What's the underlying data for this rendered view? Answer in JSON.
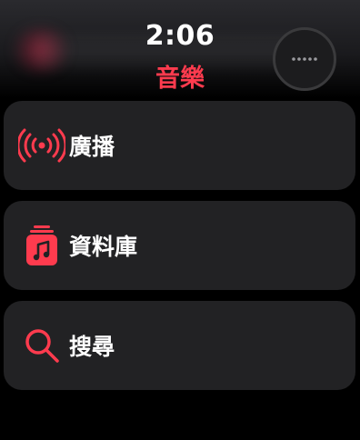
{
  "status": {
    "time": "2:06"
  },
  "header": {
    "title": "音樂",
    "title_color": "#ff3b4e",
    "more_icon": "ellipsis-icon"
  },
  "menu": {
    "items": [
      {
        "label": "廣播",
        "icon": "radio-broadcast-icon"
      },
      {
        "label": "資料庫",
        "icon": "library-icon"
      },
      {
        "label": "搜尋",
        "icon": "search-icon"
      }
    ]
  },
  "colors": {
    "accent": "#ff3b4e",
    "card": "#222224",
    "background": "#000000"
  }
}
